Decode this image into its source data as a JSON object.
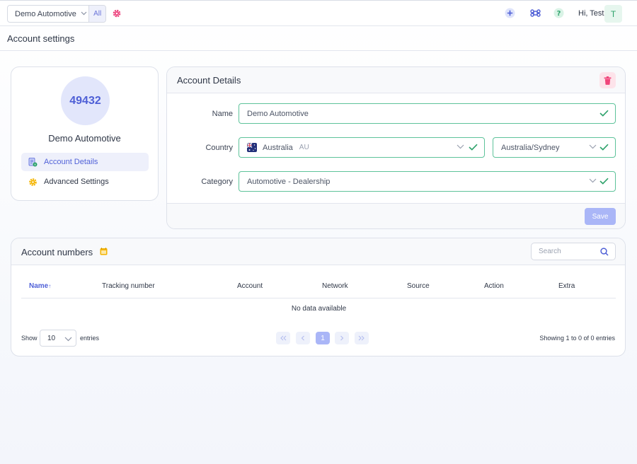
{
  "topbar": {
    "account_select": "Demo Automotive",
    "all_label": "All",
    "greeting": "Hi, Test",
    "avatar_initial": "T"
  },
  "page": {
    "title": "Account settings"
  },
  "profile": {
    "avatar_number": "49432",
    "name": "Demo Automotive",
    "menu": [
      {
        "label": "Account Details",
        "active": true,
        "icon": "document-info-icon"
      },
      {
        "label": "Advanced Settings",
        "active": false,
        "icon": "gear-icon"
      }
    ]
  },
  "details": {
    "title": "Account Details",
    "name_label": "Name",
    "name_value": "Demo Automotive",
    "country_label": "Country",
    "country_value": "Australia",
    "country_code": "AU",
    "timezone_value": "Australia/Sydney",
    "category_label": "Category",
    "category_value": "Automotive - Dealership",
    "save_label": "Save"
  },
  "numbers": {
    "title": "Account numbers",
    "search_placeholder": "Search",
    "columns": [
      "Name",
      "Tracking number",
      "Account",
      "Network",
      "Source",
      "Action",
      "Extra"
    ],
    "sorted_column": "Name",
    "sort_arrow": "↑",
    "no_data": "No data available",
    "show_label": "Show",
    "page_length": "10",
    "entries_label": "entries",
    "current_page": "1",
    "showing_text": "Showing 1 to 0 of 0 entries"
  },
  "colors": {
    "accent": "#5162d8",
    "valid": "#2ea26b",
    "danger": "#f0447a"
  }
}
